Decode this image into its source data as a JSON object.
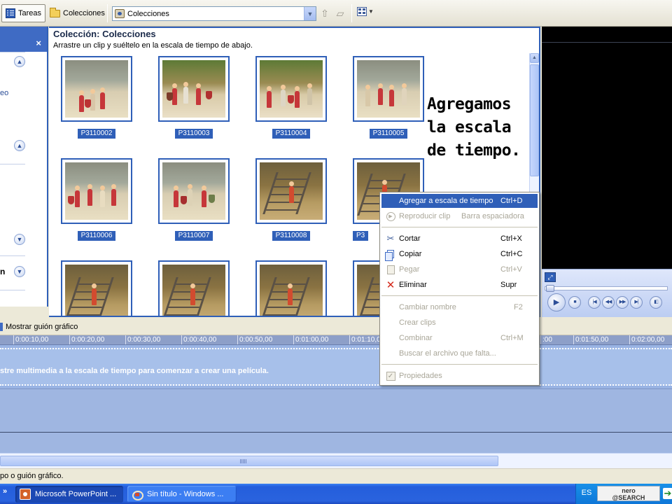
{
  "toolbar": {
    "tasks_label": "Tareas",
    "collections_label": "Colecciones",
    "collection_combo_value": "Colecciones"
  },
  "tasks_pane": {
    "fragment_1": "eo",
    "fragment_2": "n"
  },
  "collection": {
    "title": "Colección: Colecciones",
    "subtitle": "Arrastre un clip y suéltelo en la escala de tiempo de abajo.",
    "clips": [
      {
        "label": "P3110002"
      },
      {
        "label": "P3110003"
      },
      {
        "label": "P3110004"
      },
      {
        "label": "P3110005"
      },
      {
        "label": "P3110006"
      },
      {
        "label": "P3110007"
      },
      {
        "label": "P3110008"
      },
      {
        "label": "P3"
      }
    ],
    "overlay_text": "Agregamos\nla escala\nde tiempo."
  },
  "context_menu": {
    "items": [
      {
        "label": "Agregar a escala de tiempo",
        "shortcut": "Ctrl+D",
        "icon": "none",
        "state": "highlighted"
      },
      {
        "label": "Reproducir clip",
        "shortcut": "Barra espaciadora",
        "icon": "play-icon",
        "state": "disabled"
      },
      {
        "label": "Cortar",
        "shortcut": "Ctrl+X",
        "icon": "scissors-icon",
        "state": "enabled"
      },
      {
        "label": "Copiar",
        "shortcut": "Ctrl+C",
        "icon": "copy-icon",
        "state": "enabled"
      },
      {
        "label": "Pegar",
        "shortcut": "Ctrl+V",
        "icon": "paste-icon",
        "state": "disabled"
      },
      {
        "label": "Eliminar",
        "shortcut": "Supr",
        "icon": "delete-icon",
        "state": "enabled"
      },
      {
        "label": "Cambiar nombre",
        "shortcut": "F2",
        "icon": "none",
        "state": "disabled"
      },
      {
        "label": "Crear clips",
        "shortcut": "",
        "icon": "none",
        "state": "disabled"
      },
      {
        "label": "Combinar",
        "shortcut": "Ctrl+M",
        "icon": "none",
        "state": "disabled"
      },
      {
        "label": "Buscar el archivo que falta...",
        "shortcut": "",
        "icon": "none",
        "state": "disabled"
      },
      {
        "label": "Propiedades",
        "shortcut": "",
        "icon": "properties-icon",
        "state": "disabled"
      }
    ]
  },
  "timeline": {
    "storyboard_toggle": "Mostrar guión gráfico",
    "ruler_ticks": [
      "0:00:10,00",
      "0:00:20,00",
      "0:00:30,00",
      "0:00:40,00",
      "0:00:50,00",
      "0:01:00,00",
      "0:01:10,00",
      ":00",
      "0:01:50,00",
      "0:02:00,00"
    ],
    "video_track_message": "stre multimedia a la escala de tiempo para comenzar a crear una película."
  },
  "statusbar": {
    "text": "po o guión gráfico."
  },
  "taskbar": {
    "chevron": "»",
    "buttons": [
      {
        "label": "Microsoft PowerPoint ...",
        "active": true
      },
      {
        "label": "Sin título - Windows ...",
        "active": false
      }
    ],
    "language": "ES",
    "nero_line1": "nero",
    "nero_line2": "@SEARCH"
  },
  "colors": {
    "selection_blue": "#2f5fb8",
    "timeline_blue": "#a7c0ea",
    "taskbar_blue": "#2a63de"
  }
}
